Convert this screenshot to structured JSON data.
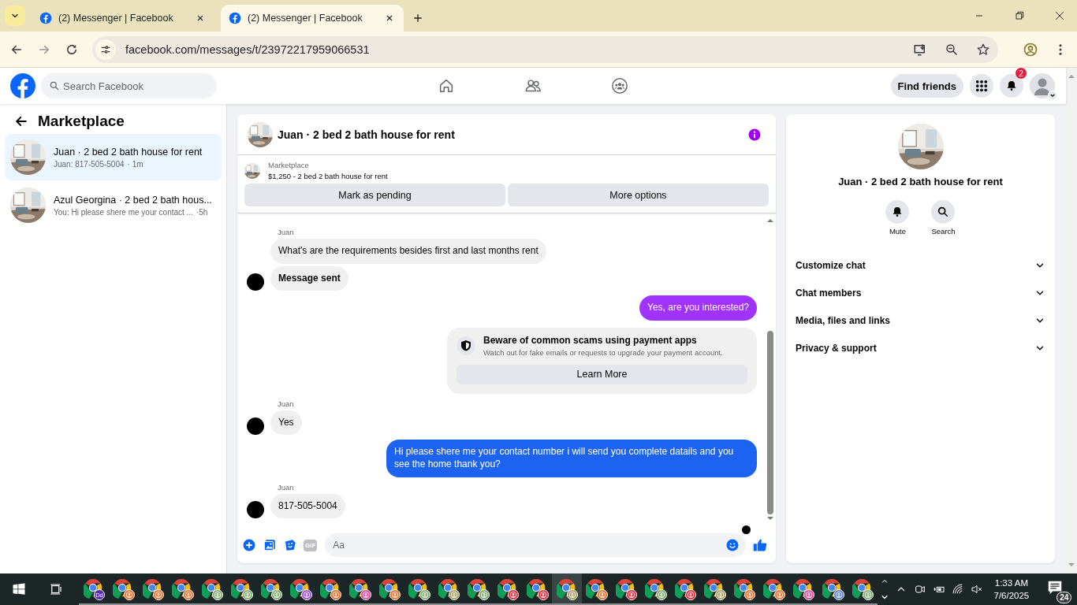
{
  "browser": {
    "tabs": [
      {
        "title": "(2) Messenger | Facebook",
        "selected": false
      },
      {
        "title": "(2) Messenger | Facebook",
        "selected": true
      }
    ],
    "url": "facebook.com/messages/t/23972217959066531"
  },
  "header": {
    "search": {
      "placeholder": "Search Facebook"
    },
    "find_friends": "Find friends",
    "notification_count": "2"
  },
  "sidebar": {
    "title": "Marketplace",
    "conversations": [
      {
        "name": "Juan · 2 bed 2 bath house for rent",
        "preview": "Juan: 817-505-5004",
        "time": "· 1m",
        "selected": true
      },
      {
        "name": "Azul Georgina · 2 bed 2 bath hous...",
        "preview": "You: Hi please shere me your contact ...",
        "time": "·5h",
        "selected": false
      }
    ]
  },
  "chat": {
    "title": "Juan · 2 bed 2 bath house for rent",
    "product": {
      "source": "Marketplace",
      "listing": "$1,250 - 2 bed 2 bath house for rent"
    },
    "actions": [
      "Mark as pending",
      "More options"
    ],
    "messages": [
      {
        "kind": "sender",
        "text": "Juan"
      },
      {
        "kind": "incoming",
        "text": "What's are the requirements besides first and last months rent",
        "avatar": false,
        "bold": false
      },
      {
        "kind": "incoming",
        "text": "Message sent",
        "avatar": true,
        "bold": true
      },
      {
        "kind": "outgoing",
        "text": "Yes, are you interested?",
        "color": "#a033ff"
      },
      {
        "kind": "notice",
        "title": "Beware of common scams using payment apps",
        "text": "Watch out for fake emails or requests to upgrade your payment account.",
        "button": "Learn More"
      },
      {
        "kind": "sender",
        "text": "Juan"
      },
      {
        "kind": "incoming",
        "text": "Yes",
        "avatar": true,
        "bold": false
      },
      {
        "kind": "outgoing",
        "text": "Hi please shere me your contact number i will send you complete datails and you see the home thank you?",
        "color": "#1e63f0"
      },
      {
        "kind": "sender",
        "text": "Juan"
      },
      {
        "kind": "incoming",
        "text": "817-505-5004",
        "avatar": true,
        "bold": false
      }
    ],
    "seen": true,
    "composer": {
      "gif_label": "GIF",
      "placeholder": "Aa"
    }
  },
  "right_panel": {
    "title": "Juan · 2 bed 2 bath house for rent",
    "actions": [
      {
        "kind": "mute",
        "label": "Mute"
      },
      {
        "kind": "search",
        "label": "Search"
      }
    ],
    "sections": [
      {
        "label": "Customize chat",
        "expanded": false
      },
      {
        "label": "Chat members",
        "expanded": false
      },
      {
        "label": "Media, files and links",
        "expanded": false
      },
      {
        "label": "Privacy & support",
        "expanded": false
      }
    ]
  },
  "taskbar": {
    "apps": [
      {
        "color": "#5b2bb5",
        "badge_text": "Dd",
        "selected": false
      },
      {
        "color": "#e8702a",
        "selected": false
      },
      {
        "color": "#e8702a",
        "selected": false
      },
      {
        "color": "#e8702a",
        "selected": false
      },
      {
        "color": "#7fae6e",
        "selected": false
      },
      {
        "color": "#7fae6e",
        "selected": false
      },
      {
        "color": "#7fae6e",
        "selected": false
      },
      {
        "color": "#9b4fd6",
        "selected": false
      },
      {
        "color": "#e8702a",
        "selected": false
      },
      {
        "color": "#e0459a",
        "selected": false
      },
      {
        "color": "#e8702a",
        "selected": false
      },
      {
        "color": "#7fae6e",
        "selected": false
      },
      {
        "color": "#a8a060",
        "selected": false
      },
      {
        "color": "#7fae6e",
        "selected": false
      },
      {
        "color": "#e8283c",
        "selected": false
      },
      {
        "color": "#e8283c",
        "selected": false
      },
      {
        "color": "#a8a060",
        "selected": true
      },
      {
        "color": "#e8702a",
        "selected": false
      },
      {
        "color": "#e8283c",
        "selected": false
      },
      {
        "color": "#7fae6e",
        "selected": false
      },
      {
        "color": "#e8283c",
        "selected": false
      },
      {
        "color": "#a8a060",
        "selected": false
      },
      {
        "color": "#e8702a",
        "selected": false
      },
      {
        "color": "#e8702a",
        "selected": false
      },
      {
        "color": "#e0459a",
        "selected": false
      },
      {
        "color": "#5b7fd6",
        "selected": false
      },
      {
        "color": "#7fae6e",
        "selected": false
      }
    ],
    "clock": {
      "time": "1:33 AM",
      "date": "7/6/2025"
    },
    "notification_count": "24"
  }
}
